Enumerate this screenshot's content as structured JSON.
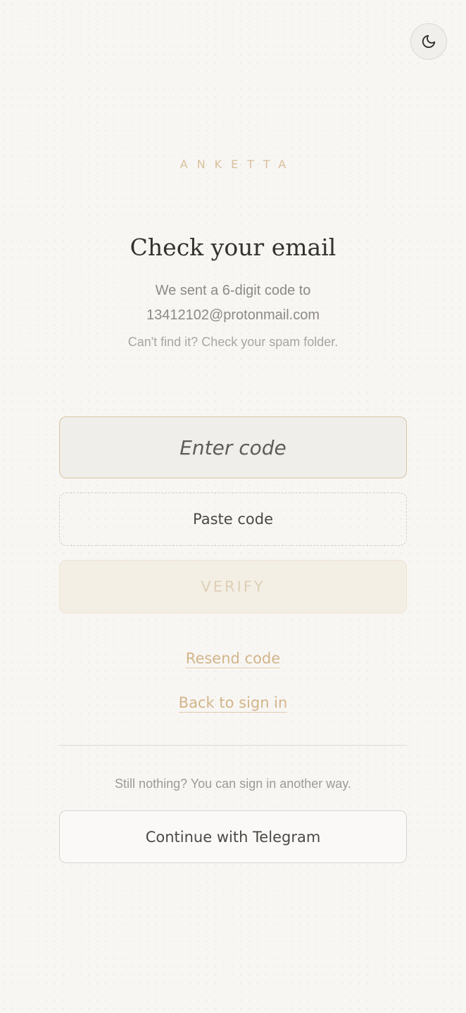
{
  "header": {
    "theme_toggle_icon": "moon-icon"
  },
  "brand": {
    "name": "ANKETTA"
  },
  "main": {
    "title": "Check your email",
    "subtitle_line1": "We sent a 6-digit code to",
    "email": "13412102@protonmail.com",
    "hint": "Can't find it? Check your spam folder."
  },
  "form": {
    "code_placeholder": "Enter code",
    "code_value": "",
    "paste_label": "Paste code",
    "verify_label": "VERIFY"
  },
  "links": {
    "resend": "Resend code",
    "back": "Back to sign in"
  },
  "alternative": {
    "text": "Still nothing? You can sign in another way.",
    "telegram_label": "Continue with Telegram"
  },
  "colors": {
    "accent": "#d2b58a",
    "background": "#f8f6f3",
    "text": "#34322f"
  }
}
